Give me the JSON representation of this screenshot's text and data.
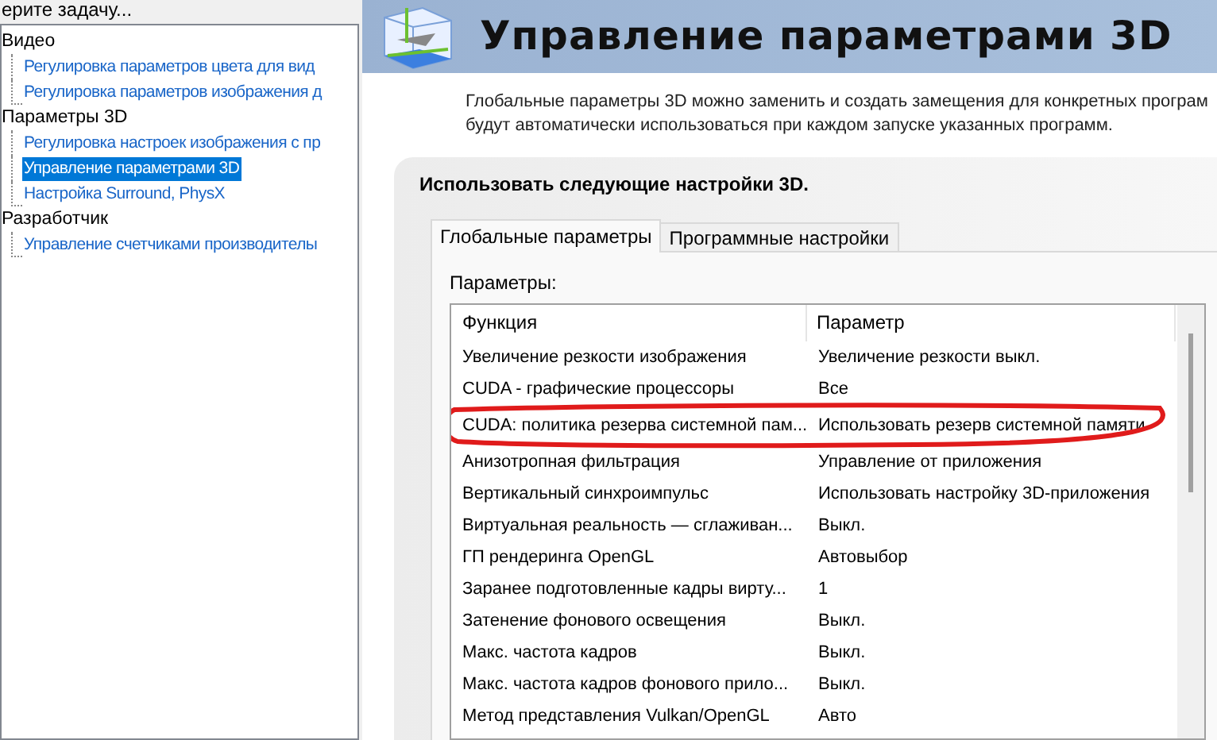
{
  "sidebar": {
    "heading": "ерите задачу...",
    "tree": [
      {
        "label": "Видео",
        "children": [
          {
            "label": "Регулировка параметров цвета для вид",
            "selected": false
          },
          {
            "label": "Регулировка параметров изображения д",
            "selected": false
          }
        ]
      },
      {
        "label": "Параметры 3D",
        "children": [
          {
            "label": "Регулировка настроек изображения с пр",
            "selected": false
          },
          {
            "label": "Управление параметрами 3D",
            "selected": true
          },
          {
            "label": "Настройка Surround, PhysX",
            "selected": false
          }
        ]
      },
      {
        "label": "Разработчик",
        "children": [
          {
            "label": "Управление счетчиками производителы",
            "selected": false
          }
        ]
      }
    ]
  },
  "page": {
    "title": "Управление параметрами 3D",
    "description": "Глобальные параметры 3D можно заменить и создать замещения для конкретных програм будут автоматически использоваться при каждом запуске указанных программ.",
    "section_title": "Использовать следующие настройки 3D.",
    "tabs": [
      {
        "label": "Глобальные параметры",
        "selected": true
      },
      {
        "label": "Программные настройки",
        "selected": false
      }
    ],
    "list_label": "Параметры:",
    "table": {
      "columns": [
        "Функция",
        "Параметр"
      ],
      "rows": [
        {
          "cells": [
            "Увеличение резкости изображения",
            "Увеличение резкости выкл."
          ],
          "circled": false
        },
        {
          "cells": [
            "CUDA - графические процессоры",
            "Все"
          ],
          "circled": false
        },
        {
          "cells": [
            "CUDA: политика резерва системной пам...",
            "Использовать резерв системной памяти"
          ],
          "circled": true
        },
        {
          "cells": [
            "Анизотропная фильтрация",
            "Управление от приложения"
          ],
          "circled": false
        },
        {
          "cells": [
            "Вертикальный синхроимпульс",
            "Использовать настройку 3D-приложения"
          ],
          "circled": false
        },
        {
          "cells": [
            "Виртуальная реальность — сглаживан...",
            "Выкл."
          ],
          "circled": false
        },
        {
          "cells": [
            "ГП рендеринга OpenGL",
            "Автовыбор"
          ],
          "circled": false
        },
        {
          "cells": [
            "Заранее подготовленные кадры вирту...",
            "1"
          ],
          "circled": false
        },
        {
          "cells": [
            "Затенение фонового освещения",
            "Выкл."
          ],
          "circled": false
        },
        {
          "cells": [
            "Макс. частота кадров",
            "Выкл."
          ],
          "circled": false
        },
        {
          "cells": [
            "Макс. частота кадров фонового прило...",
            "Выкл."
          ],
          "circled": false
        },
        {
          "cells": [
            "Метод представления Vulkan/OpenGL",
            "Авто"
          ],
          "circled": false
        }
      ]
    }
  }
}
